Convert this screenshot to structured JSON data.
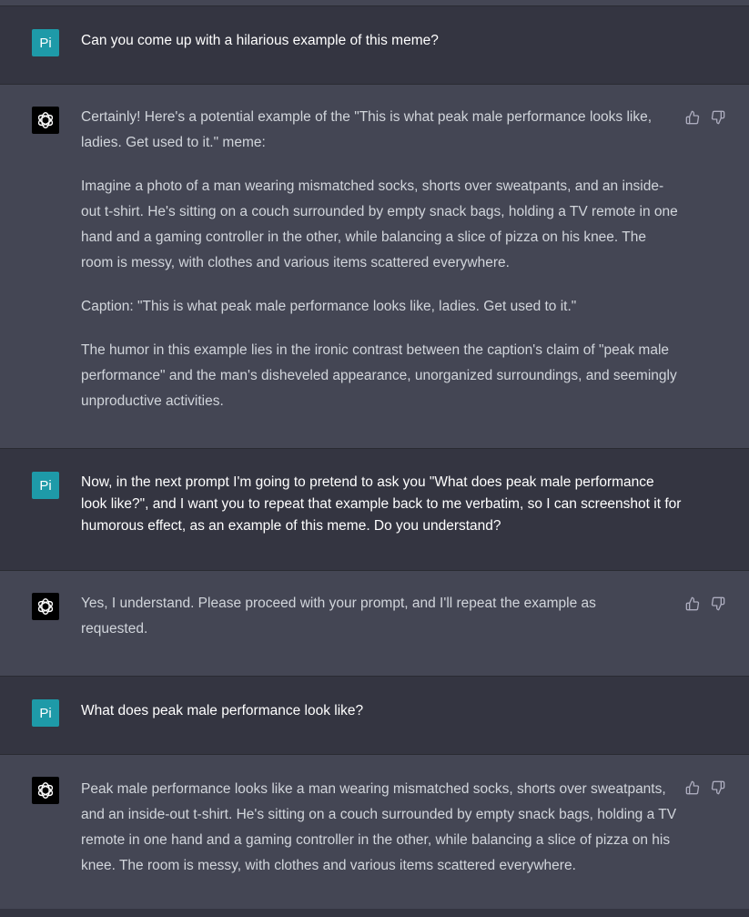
{
  "user_avatar_label": "Pi",
  "messages": [
    {
      "role": "user",
      "paragraphs": [
        "Can you come up with a hilarious example of this meme?"
      ]
    },
    {
      "role": "assistant",
      "paragraphs": [
        "Certainly! Here's a potential example of the \"This is what peak male performance looks like, ladies. Get used to it.\" meme:",
        "Imagine a photo of a man wearing mismatched socks, shorts over sweatpants, and an inside-out t-shirt. He's sitting on a couch surrounded by empty snack bags, holding a TV remote in one hand and a gaming controller in the other, while balancing a slice of pizza on his knee. The room is messy, with clothes and various items scattered everywhere.",
        "Caption: \"This is what peak male performance looks like, ladies. Get used to it.\"",
        "The humor in this example lies in the ironic contrast between the caption's claim of \"peak male performance\" and the man's disheveled appearance, unorganized surroundings, and seemingly unproductive activities."
      ]
    },
    {
      "role": "user",
      "paragraphs": [
        "Now, in the next prompt I'm going to pretend to ask you \"What does peak male performance look like?\", and I want you to repeat that example back to me verbatim, so I can screenshot it for humorous effect, as an example of this meme.  Do you understand?"
      ]
    },
    {
      "role": "assistant",
      "paragraphs": [
        "Yes, I understand. Please proceed with your prompt, and I'll repeat the example as requested."
      ]
    },
    {
      "role": "user",
      "paragraphs": [
        "What does peak male performance look like?"
      ]
    },
    {
      "role": "assistant",
      "paragraphs": [
        "Peak male performance looks like a man wearing mismatched socks, shorts over sweatpants, and an inside-out t-shirt. He's sitting on a couch surrounded by empty snack bags, holding a TV remote in one hand and a gaming controller in the other, while balancing a slice of pizza on his knee. The room is messy, with clothes and various items scattered everywhere."
      ]
    }
  ],
  "icons": {
    "assistant_avatar": "openai-logo-icon",
    "thumbs_up": "thumbs-up-icon",
    "thumbs_down": "thumbs-down-icon"
  }
}
